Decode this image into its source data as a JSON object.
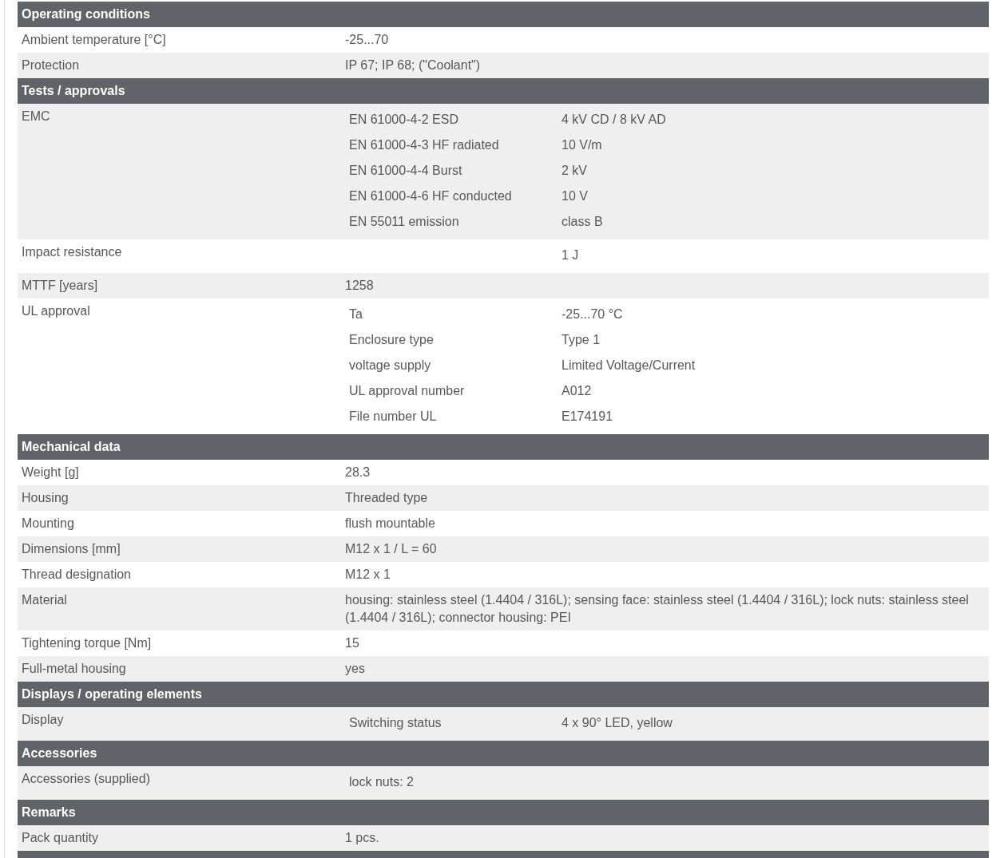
{
  "sections": [
    {
      "title": "Operating conditions",
      "rows": [
        {
          "label": "Ambient temperature [°C]",
          "value": "-25...70",
          "shaded": false
        },
        {
          "label": "Protection",
          "value": "IP 67; IP 68; (\"Coolant\")",
          "shaded": true
        }
      ]
    },
    {
      "title": "Tests / approvals",
      "rows": [
        {
          "label": "EMC",
          "shaded": true,
          "details": [
            {
              "name": "EN 61000-4-2 ESD",
              "value": "4 kV CD / 8 kV AD"
            },
            {
              "name": "EN 61000-4-3 HF radiated",
              "value": "10 V/m"
            },
            {
              "name": "EN 61000-4-4 Burst",
              "value": "2 kV"
            },
            {
              "name": "EN 61000-4-6 HF conducted",
              "value": "10 V"
            },
            {
              "name": "EN 55011 emission",
              "value": "class B"
            }
          ]
        },
        {
          "label": "Impact resistance",
          "shaded": false,
          "details": [
            {
              "value": "1 J"
            }
          ]
        },
        {
          "label": "MTTF [years]",
          "value": "1258",
          "shaded": true
        },
        {
          "label": "UL approval",
          "shaded": false,
          "details": [
            {
              "name": "Ta",
              "value": "-25...70 °C"
            },
            {
              "name": "Enclosure type",
              "value": "Type 1"
            },
            {
              "name": "voltage supply",
              "value": "Limited Voltage/Current"
            },
            {
              "name": "UL approval number",
              "value": "A012"
            },
            {
              "name": "File number UL",
              "value": "E174191"
            }
          ]
        }
      ]
    },
    {
      "title": "Mechanical data",
      "rows": [
        {
          "label": "Weight [g]",
          "value": "28.3",
          "shaded": false
        },
        {
          "label": "Housing",
          "value": "Threaded type",
          "shaded": true
        },
        {
          "label": "Mounting",
          "value": "flush mountable",
          "shaded": false
        },
        {
          "label": "Dimensions [mm]",
          "value": "M12 x 1 / L = 60",
          "shaded": true
        },
        {
          "label": "Thread designation",
          "value": "M12 x 1",
          "shaded": false
        },
        {
          "label": "Material",
          "value": "housing: stainless steel (1.4404 / 316L); sensing face: stainless steel (1.4404 / 316L); lock nuts: stainless steel (1.4404 / 316L); connector housing: PEI",
          "shaded": true
        },
        {
          "label": "Tightening torque [Nm]",
          "value": "15",
          "shaded": false
        },
        {
          "label": "Full-metal housing",
          "value": "yes",
          "shaded": true
        }
      ]
    },
    {
      "title": "Displays / operating elements",
      "rows": [
        {
          "label": "Display",
          "shaded": true,
          "details": [
            {
              "name": "Switching status",
              "value": "4 x 90° LED, yellow"
            }
          ]
        }
      ]
    },
    {
      "title": "Accessories",
      "rows": [
        {
          "label": "Accessories (supplied)",
          "shaded": true,
          "details": [
            {
              "name": "lock nuts: 2"
            }
          ]
        }
      ]
    },
    {
      "title": "Remarks",
      "rows": [
        {
          "label": "Pack quantity",
          "value": "1 pcs.",
          "shaded": true
        }
      ]
    },
    {
      "cut_off": true
    }
  ]
}
